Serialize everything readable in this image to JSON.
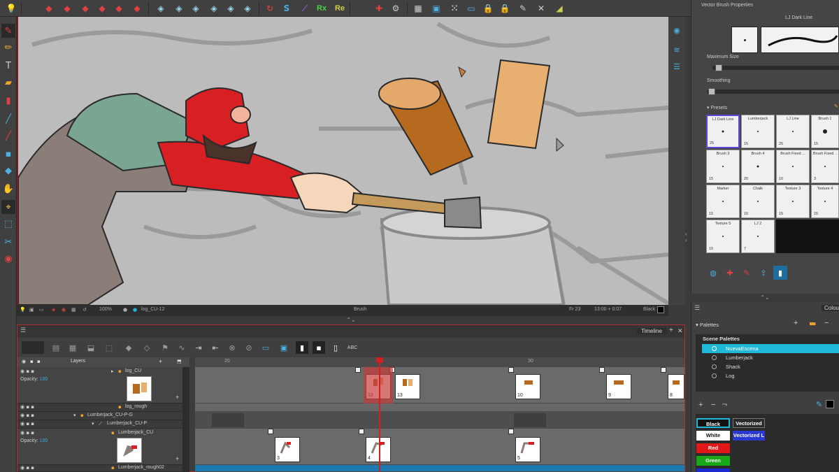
{
  "top_toolbar": {
    "colors": {
      "bg": "#404040"
    },
    "tool_glyphs": [
      "rx_label",
      "re_label"
    ],
    "rx_label": "Rx",
    "re_label": "Re"
  },
  "camera_status": {
    "zoom": "100%",
    "drawing_name": "log_CU-12",
    "tool": "Brush",
    "frame": "Fr 23",
    "timecode": "13:00 + 0:07",
    "colour": "Black"
  },
  "timeline": {
    "tab_label": "Timeline",
    "layers_header": "Layers",
    "ruler_ticks": [
      "20",
      "30"
    ],
    "opacity_label": "Opacity:",
    "opacity_value": "100",
    "layers": [
      {
        "name": "log_CU"
      },
      {
        "name": "log_rough"
      },
      {
        "name": "Lumberjack_CU-P-G"
      },
      {
        "name": "Lumberjack_CU-P"
      },
      {
        "name": "Lumberjack_CU"
      },
      {
        "name": "Lumberjack_rough02"
      }
    ],
    "keys_row1": [
      "12",
      "13",
      "10",
      "9",
      "8"
    ],
    "keys_row2": [
      "3",
      "4",
      "5"
    ],
    "abc_label": "ABC"
  },
  "brush_panel": {
    "title": "Vector Brush Properties",
    "preset_name": "LJ Dark Line",
    "maximum_size_label": "Maximum Size",
    "smoothing_label": "Smoothing",
    "presets_label": "Presets",
    "presets": [
      {
        "name": "LJ Dark Line",
        "size": "25"
      },
      {
        "name": "Lumberjack",
        "size": "15"
      },
      {
        "name": "LJ Line",
        "size": "25"
      },
      {
        "name": "Brush 1",
        "size": "15"
      },
      {
        "name": "Brush 3",
        "size": "15"
      },
      {
        "name": "Brush 4",
        "size": "20"
      },
      {
        "name": "Brush Fixed ...",
        "size": "10"
      },
      {
        "name": "Brush Fixed ...",
        "size": "3"
      },
      {
        "name": "Marker",
        "size": "15"
      },
      {
        "name": "Chalk",
        "size": "15"
      },
      {
        "name": "Texture 3",
        "size": "15"
      },
      {
        "name": "Texture 4",
        "size": "15"
      },
      {
        "name": "Texture 5",
        "size": "15"
      },
      {
        "name": "LJ 2",
        "size": "7"
      }
    ]
  },
  "palettes_panel": {
    "colour_tab": "Colou",
    "title": "Palettes",
    "scene_palettes_label": "Scene Palettes",
    "palettes": [
      "NuevaEscena",
      "Lumberjack",
      "Shack",
      "Log"
    ],
    "swatches": [
      {
        "name": "Black",
        "color": "#111111",
        "text": "#ffffff"
      },
      {
        "name": "Vectorized L",
        "color": "#2a2a2a",
        "text": "#ffffff"
      },
      {
        "name": "White",
        "color": "#ffffff",
        "text": "#111111"
      },
      {
        "name": "Vectorized L",
        "color": "#2a3ad0",
        "text": "#ffffff"
      },
      {
        "name": "Red",
        "color": "#e01818",
        "text": "#ffffff"
      },
      {
        "name": "Green",
        "color": "#18a818",
        "text": "#ffffff"
      },
      {
        "name": "Blue",
        "color": "#1a2ad0",
        "text": "#ffffff"
      }
    ]
  },
  "colors": {
    "accent_cyan": "#1fb8d8",
    "selection_red": "#d02020",
    "preset_selected": "#5a4ad8"
  }
}
